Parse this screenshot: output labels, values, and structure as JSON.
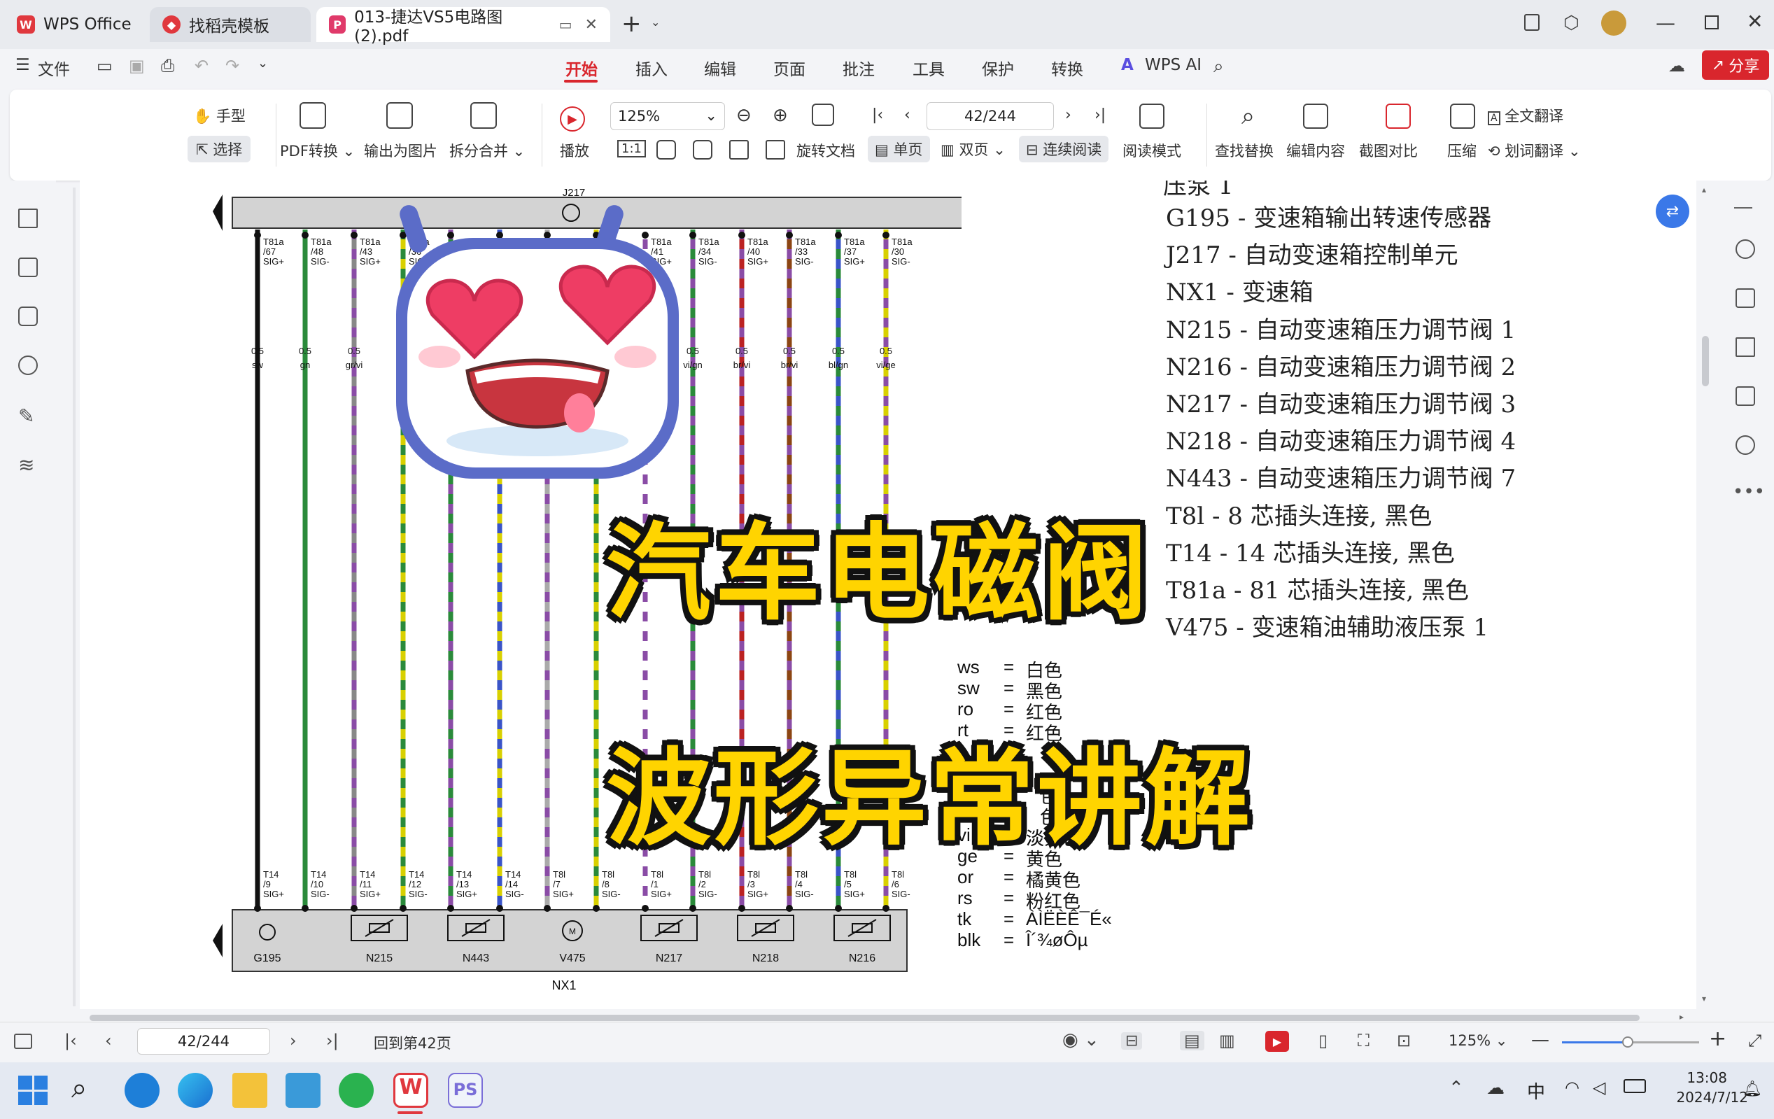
{
  "tabs": [
    {
      "label": "WPS Office"
    },
    {
      "label": "找稻壳模板"
    },
    {
      "label": "013-捷达VS5电路图(2).pdf"
    }
  ],
  "menu": {
    "file": "文件",
    "items": [
      "开始",
      "插入",
      "编辑",
      "页面",
      "批注",
      "工具",
      "保护",
      "转换",
      "WPS AI"
    ],
    "share": "分享"
  },
  "ribbon": {
    "hand": "手型",
    "select": "选择",
    "pdf_convert": "PDF转换",
    "export_image": "输出为图片",
    "split_merge": "拆分合并",
    "play": "播放",
    "zoom": "125%",
    "page": "42/244",
    "rotate": "旋转文档",
    "single": "单页",
    "double": "双页",
    "continuous": "连续阅读",
    "read_mode": "阅读模式",
    "find_replace": "查找替换",
    "edit_content": "编辑内容",
    "screenshot_compare": "截图对比",
    "compress": "压缩",
    "full_translate": "全文翻译",
    "word_translate": "划词翻译"
  },
  "schematic": {
    "top_unit": "J217",
    "top_pins": [
      {
        "pin": "T81a\n/67",
        "sig": "SIG+",
        "gauge": "0.5",
        "color": "sw"
      },
      {
        "pin": "T81a\n/48",
        "sig": "SIG-",
        "gauge": "0.5",
        "color": "gn"
      },
      {
        "pin": "T81a\n/43",
        "sig": "SIG+",
        "gauge": "0.5",
        "color": "gr/vi"
      },
      {
        "pin": "T81a\n/36",
        "sig": "SIG-",
        "gauge": "0.5",
        "color": "g"
      },
      {
        "pin": "T81a\n/41",
        "sig": "SIG+",
        "gauge": "0.5",
        "color": ""
      },
      {
        "pin": "T81a\n/34",
        "sig": "SIG-",
        "gauge": "0.5",
        "color": "vi/gn"
      },
      {
        "pin": "T81a\n/40",
        "sig": "SIG+",
        "gauge": "0.5",
        "color": "br/vi"
      },
      {
        "pin": "T81a\n/33",
        "sig": "SIG-",
        "gauge": "0.5",
        "color": "br/vi"
      },
      {
        "pin": "T81a\n/37",
        "sig": "SIG+",
        "gauge": "0.5",
        "color": "bl/gn"
      },
      {
        "pin": "T81a\n/30",
        "sig": "SIG-",
        "gauge": "0.5",
        "color": "vi/ge"
      }
    ],
    "bottom_pins": [
      "T14 /9",
      "T14 /10",
      "T14 /11",
      "T14 /12",
      "T14 /13",
      "T14 /14",
      "T8l /7",
      "T8l /8",
      "T8l /1",
      "T8l /2",
      "T8l /3",
      "T8l /4",
      "T8l /5",
      "T8l /6"
    ],
    "bottom_sig": [
      "SIG+",
      "SIG-",
      "SIG+",
      "SIG-",
      "SIG+",
      "SIG-",
      "SIG+",
      "SIG-",
      "SIG+",
      "SIG-",
      "SIG+",
      "SIG-",
      "SIG+",
      "SIG-"
    ],
    "components": [
      "G195",
      "N215",
      "N443",
      "V475",
      "N217",
      "N218",
      "N216"
    ],
    "bottom_unit": "NX1"
  },
  "legend": {
    "partial": "压泵 1",
    "items": [
      "G195 - 变速箱输出转速传感器",
      "J217 - 自动变速箱控制单元",
      "NX1 - 变速箱",
      "N215 - 自动变速箱压力调节阀 1",
      "N216 - 自动变速箱压力调节阀 2",
      "N217 - 自动变速箱压力调节阀 3",
      "N218 - 自动变速箱压力调节阀 4",
      "N443 - 自动变速箱压力调节阀 7",
      "T8l - 8 芯插头连接, 黑色",
      "T14 - 14 芯插头连接, 黑色",
      "T81a - 81 芯插头连接, 黑色",
      "V475 - 变速箱油辅助液压泵 1"
    ]
  },
  "color_codes": [
    {
      "code": "ws",
      "eq": "=",
      "name": "白色"
    },
    {
      "code": "sw",
      "eq": "=",
      "name": "黑色"
    },
    {
      "code": "ro",
      "eq": "=",
      "name": "红色"
    },
    {
      "code": "rt",
      "eq": "=",
      "name": "红色"
    },
    {
      "code": "vi",
      "eq": "=",
      "name": "淡紫色"
    },
    {
      "code": "ge",
      "eq": "=",
      "name": "黄色"
    },
    {
      "code": "or",
      "eq": "=",
      "name": "橘黄色"
    },
    {
      "code": "rs",
      "eq": "=",
      "name": "粉红色"
    },
    {
      "code": "tk",
      "eq": "=",
      "name": "ÀÌËÈÊ¯É«"
    },
    {
      "code": "blk",
      "eq": "=",
      "name": "Î´¾øÔµ"
    }
  ],
  "color_codes_partial": [
    "色",
    "色",
    "淡紫色"
  ],
  "overlay": {
    "line1": "汽车电磁阀",
    "line2": "波形异常讲解"
  },
  "status": {
    "page": "42/244",
    "back": "回到第42页",
    "zoom": "125%"
  },
  "clock": {
    "time": "13:08",
    "date": "2024/7/12",
    "ime": "中"
  },
  "colors": {
    "wps_red": "#e0383e",
    "accent_red": "#d9262d",
    "highlight_yellow": "#ffd400"
  }
}
